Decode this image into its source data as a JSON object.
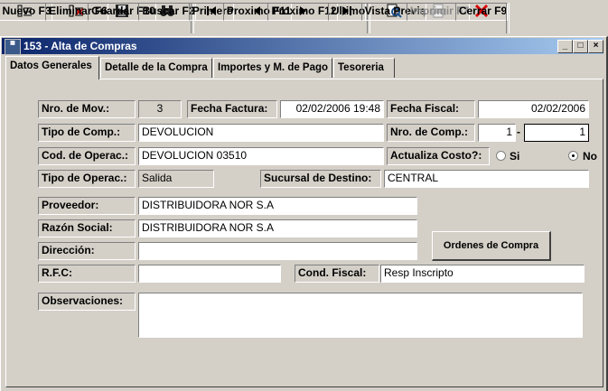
{
  "toolbar": {
    "buttons": [
      {
        "label": "Nuevo F3",
        "icon": "new-icon"
      },
      {
        "label": "Eliminar F6",
        "icon": "delete-icon"
      },
      {
        "label": "Guardar F10",
        "icon": "save-icon"
      },
      {
        "label": "Buscar F2",
        "icon": "search-icon"
      },
      {
        "label": "Primero",
        "icon": "first-icon"
      },
      {
        "label": "Proximo F11",
        "icon": "previous-icon"
      },
      {
        "label": "Proximo F12",
        "icon": "next-icon"
      },
      {
        "label": "Ultimo",
        "icon": "last-icon"
      },
      {
        "label": "Vista Previa",
        "icon": "preview-icon"
      },
      {
        "label": "Imprimir F7",
        "icon": "print-icon"
      },
      {
        "label": "Cerrar F9",
        "icon": "close-icon"
      }
    ]
  },
  "window": {
    "title": "153 - Alta de Compras",
    "controls": {
      "minimize": "_",
      "restore": "□",
      "close": "×"
    }
  },
  "tabs": [
    {
      "label": "Datos Generales",
      "active": true
    },
    {
      "label": "Detalle de la Compra"
    },
    {
      "label": "Importes y M. de Pago"
    },
    {
      "label": "Tesoreria"
    }
  ],
  "form": {
    "nro_mov": {
      "label": "Nro. de Mov.:",
      "value": "3"
    },
    "fecha_factura": {
      "label": "Fecha Factura:",
      "value": "02/02/2006 19:48"
    },
    "fecha_fiscal": {
      "label": "Fecha Fiscal:",
      "value": "02/02/2006"
    },
    "tipo_comp": {
      "label": "Tipo de Comp.:",
      "value": "DEVOLUCION"
    },
    "nro_comp": {
      "label": "Nro. de Comp.:",
      "value1": "1",
      "sep": "-",
      "value2": "1"
    },
    "cod_operac": {
      "label": "Cod. de Operac.:",
      "value": "DEVOLUCION  03510"
    },
    "actualiza_costo": {
      "label": "Actualiza Costo?:",
      "opt_si": "Si",
      "opt_no": "No",
      "selected": "No"
    },
    "tipo_operac": {
      "label": "Tipo de Operac.:",
      "value": "Salida"
    },
    "sucursal_destino": {
      "label": "Sucursal de Destino:",
      "value": "CENTRAL"
    },
    "proveedor": {
      "label": "Proveedor:",
      "value": "DISTRIBUIDORA NOR S.A"
    },
    "razon_social": {
      "label": "Razón Social:",
      "value": "DISTRIBUIDORA NOR S.A"
    },
    "direccion": {
      "label": "Dirección:",
      "value": ""
    },
    "rfc": {
      "label": "R.F.C:",
      "value": ""
    },
    "cond_fiscal": {
      "label": "Cond. Fiscal:",
      "value": "Resp Inscripto"
    },
    "observaciones": {
      "label": "Observaciones:",
      "value": ""
    },
    "ordenes_button": "Ordenes de Compra"
  }
}
